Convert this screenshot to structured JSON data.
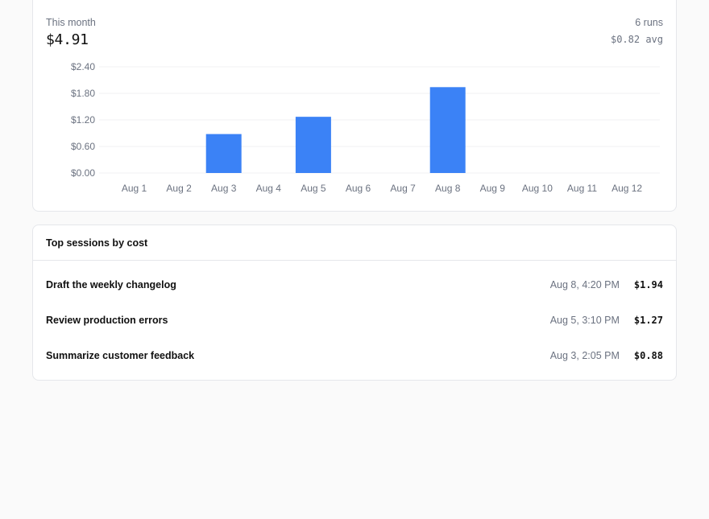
{
  "usage": {
    "period_label": "This month",
    "total_cost": "$4.91",
    "runs": "6 runs",
    "avg": "$0.82 avg"
  },
  "colors": {
    "accent": "#3b82f6",
    "muted_text": "#6b7280",
    "border": "#e5e7eb",
    "grid": "#f0f1f3"
  },
  "chart_data": {
    "type": "bar",
    "title": "",
    "xlabel": "",
    "ylabel": "",
    "categories": [
      "Aug 1",
      "Aug 2",
      "Aug 3",
      "Aug 4",
      "Aug 5",
      "Aug 6",
      "Aug 7",
      "Aug 8",
      "Aug 9",
      "Aug 10",
      "Aug 11",
      "Aug 12"
    ],
    "values": [
      0,
      0,
      0.88,
      0,
      1.27,
      0,
      0,
      1.94,
      0,
      0,
      0,
      0
    ],
    "yticks": [
      0,
      0.6,
      1.2,
      1.8,
      2.4
    ],
    "ytick_labels": [
      "$0.00",
      "$0.60",
      "$1.20",
      "$1.80",
      "$2.40"
    ],
    "ylim": [
      0,
      2.4
    ],
    "grid": true,
    "legend": "none"
  },
  "sessions": {
    "title": "Top sessions by cost",
    "items": [
      {
        "title": "Draft the weekly changelog",
        "date": "Aug 8, 4:20 PM",
        "cost": "$1.94"
      },
      {
        "title": "Review production errors",
        "date": "Aug 5, 3:10 PM",
        "cost": "$1.27"
      },
      {
        "title": "Summarize customer feedback",
        "date": "Aug 3, 2:05 PM",
        "cost": "$0.88"
      }
    ]
  }
}
